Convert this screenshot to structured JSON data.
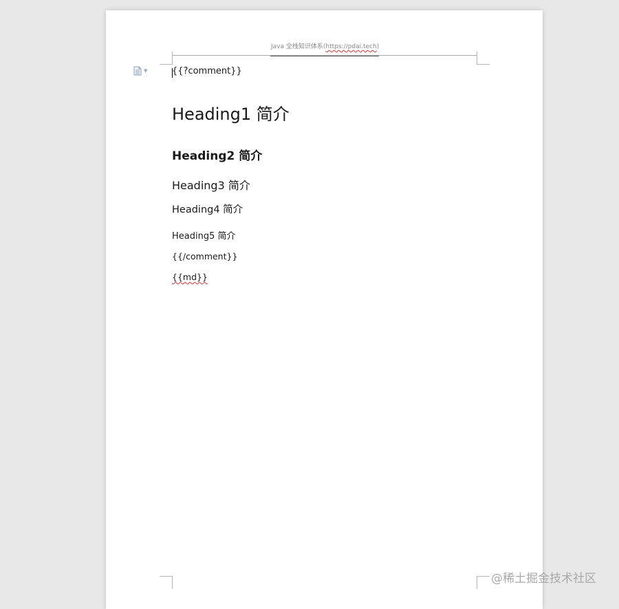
{
  "header": {
    "prefix": "Java 全栈知识体系(",
    "link": "https://pdai.tech",
    "suffix": ")"
  },
  "body": {
    "comment_open": "{{?comment}}",
    "h1": "Heading1 简介",
    "h2": "Heading2 简介",
    "h3": "Heading3 简介",
    "h4": "Heading4 简介",
    "h5": "Heading5 简介",
    "comment_close": "{{/comment}}",
    "md": "{{md}}"
  },
  "watermark": "@稀土掘金技术社区",
  "icons": {
    "paragraph_options": "document-options-icon"
  },
  "colors": {
    "background": "#e8e8e8",
    "page": "#ffffff",
    "spellcheck": "#e03030"
  }
}
